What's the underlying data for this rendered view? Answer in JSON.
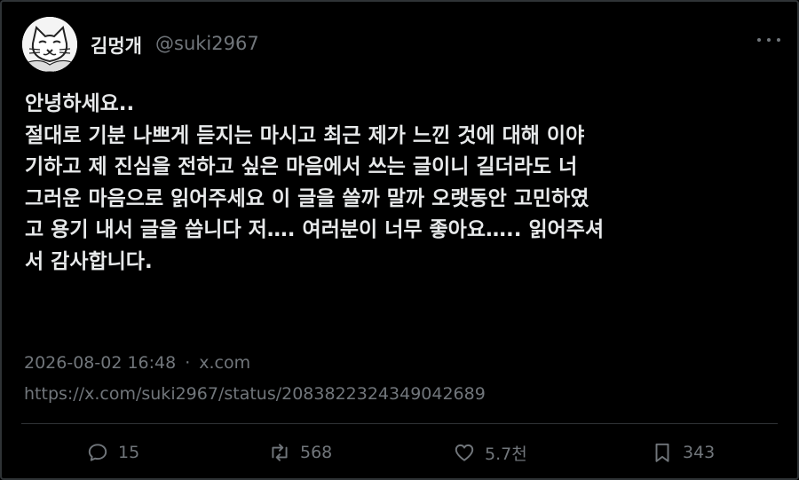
{
  "header": {
    "name": "김멍개",
    "handle": "@suki2967",
    "avatar_icon": "cat-avatar-icon",
    "more_icon": "more-options-icon"
  },
  "tweet": {
    "lines": [
      "안녕하세요..",
      "절대로 기분 나쁘게 듣지는 마시고 최근 제가 느낀 것에 대해 이야",
      "기하고 제 진심을 전하고 싶은 마음에서 쓰는 글이니 길더라도 너",
      "그러운 마음으로 읽어주세요 이 글을 쓸까 말까 오랫동안 고민하였",
      "고 용기 내서 글을 씁니다 저…. 여러분이 너무 좋아요….. 읽어주셔",
      "서 감사합니다."
    ]
  },
  "meta": {
    "timestamp": "2026-08-02 16:48",
    "separator": "·",
    "source": "x.com",
    "url": "https://x.com/suki2967/status/2083822324349042689"
  },
  "actions": {
    "replies": {
      "icon": "reply-icon",
      "count": "15"
    },
    "reposts": {
      "icon": "repost-icon",
      "count": "568"
    },
    "likes": {
      "icon": "heart-icon",
      "count": "5.7천"
    },
    "bookmarks": {
      "icon": "bookmark-icon",
      "count": "343"
    }
  },
  "colors": {
    "background": "#000000",
    "text": "#e7e9ea",
    "muted": "#71767b",
    "border": "#2f3336"
  }
}
